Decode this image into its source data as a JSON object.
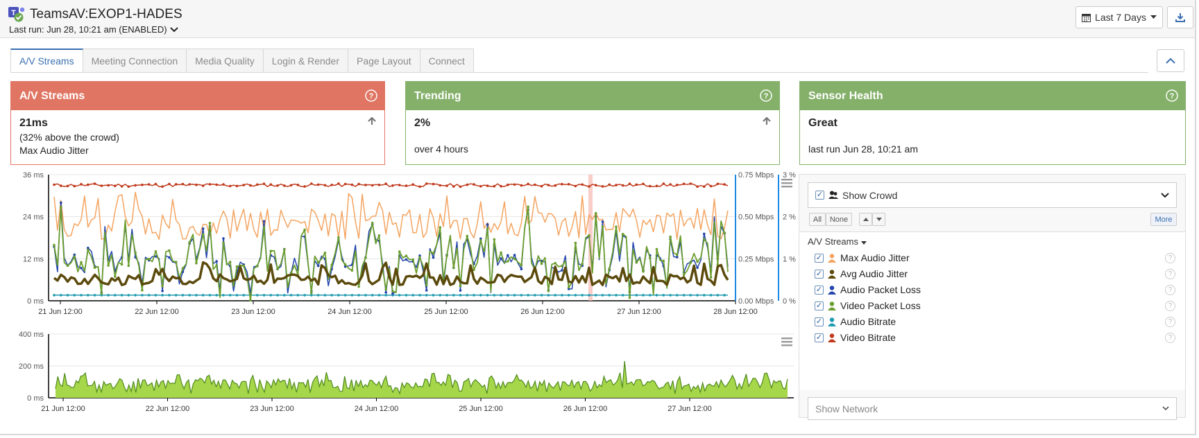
{
  "header": {
    "title": "TeamsAV:EXOP1-HADES",
    "last_run": "Last run: Jun 28, 10:21 am (ENABLED)",
    "date_range": "Last 7 Days"
  },
  "tabs": [
    {
      "label": "A/V Streams",
      "active": true
    },
    {
      "label": "Meeting Connection"
    },
    {
      "label": "Media Quality"
    },
    {
      "label": "Login & Render"
    },
    {
      "label": "Page Layout"
    },
    {
      "label": "Connect"
    }
  ],
  "cards": [
    {
      "title": "A/V Streams",
      "value": "21ms",
      "line1": "(32% above the crowd)",
      "line2": "Max Audio Jitter",
      "color": "#e07563"
    },
    {
      "title": "Trending",
      "value": "2%",
      "line1": "",
      "line2": "over 4 hours",
      "color": "#84b06a"
    },
    {
      "title": "Sensor Health",
      "value": "Great",
      "line1": "",
      "line2": "last run Jun 28, 10:21 am",
      "color": "#84b06a"
    }
  ],
  "main_chart": {
    "y_left_ticks": [
      "36 ms",
      "24 ms",
      "12 ms",
      "0 ms"
    ],
    "y_right_ticks": [
      "0.75 Mbps",
      "0.50 Mbps",
      "0.25 Mbps",
      "0.00 Mbps"
    ],
    "y_right2_ticks": [
      "3 %",
      "2 %",
      "1 %",
      "0 %"
    ],
    "x_ticks": [
      "21 Jun 12:00",
      "22 Jun 12:00",
      "23 Jun 12:00",
      "24 Jun 12:00",
      "25 Jun 12:00",
      "26 Jun 12:00",
      "27 Jun 12:00",
      "28 Jun 12:00"
    ]
  },
  "network_chart": {
    "y_ticks": [
      "400 ms",
      "200 ms",
      "0 ms"
    ],
    "x_ticks": [
      "21 Jun 12:00",
      "22 Jun 12:00",
      "23 Jun 12:00",
      "24 Jun 12:00",
      "25 Jun 12:00",
      "26 Jun 12:00",
      "27 Jun 12:00"
    ]
  },
  "chart_data": [
    {
      "type": "line",
      "x_range": [
        "21 Jun 08:00",
        "28 Jun 10:21"
      ],
      "axes": {
        "left": "ms",
        "right": "Mbps",
        "right2": "%"
      },
      "ylim_left": [
        0,
        36
      ],
      "ylim_right": [
        0,
        0.75
      ],
      "ylim_right2": [
        0,
        3
      ],
      "series": [
        {
          "name": "Max Audio Jitter",
          "color": "#f4a460",
          "approx_range_ms": [
            17,
            30
          ]
        },
        {
          "name": "Avg Audio Jitter",
          "color": "#5b4a0c",
          "approx_range_ms": [
            3,
            10
          ]
        },
        {
          "name": "Audio Packet Loss",
          "color": "#2244aa",
          "approx_range": [
            0,
            27
          ]
        },
        {
          "name": "Video Packet Loss",
          "color": "#6b9e2e",
          "approx_range": [
            0,
            27
          ]
        },
        {
          "name": "Audio Bitrate",
          "color": "#1e9ab0",
          "approx_value": 0.04
        },
        {
          "name": "Video Bitrate",
          "color": "#c0391b",
          "approx_value": 0.7
        }
      ]
    },
    {
      "type": "area",
      "ylim": [
        0,
        400
      ],
      "series": [
        {
          "name": "",
          "color": "#a6d64a",
          "approx_range_ms": [
            20,
            230
          ]
        }
      ]
    }
  ],
  "side_panel": {
    "show_crowd": "Show Crowd",
    "all": "All",
    "none": "None",
    "more": "More",
    "group": "A/V Streams",
    "legend": [
      {
        "label": "Max Audio Jitter",
        "color": "#f4a460",
        "icon": "person-icon"
      },
      {
        "label": "Avg Audio Jitter",
        "color": "#5b4a0c",
        "icon": "person-icon"
      },
      {
        "label": "Audio Packet Loss",
        "color": "#2244aa",
        "icon": "person-icon"
      },
      {
        "label": "Video Packet Loss",
        "color": "#6b9e2e",
        "icon": "person-icon"
      },
      {
        "label": "Audio Bitrate",
        "color": "#1e9ab0",
        "icon": "person-icon"
      },
      {
        "label": "Video Bitrate",
        "color": "#c0391b",
        "icon": "person-icon"
      }
    ],
    "show_network": "Show Network"
  }
}
